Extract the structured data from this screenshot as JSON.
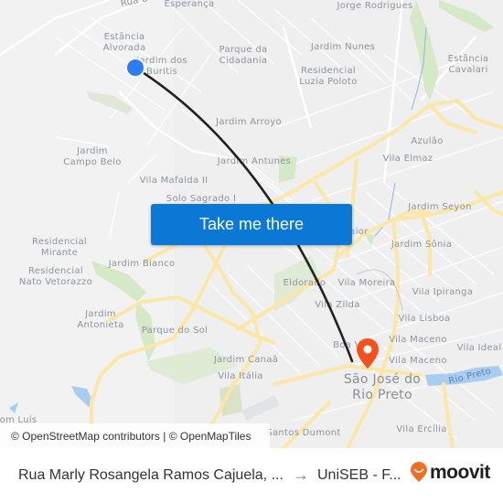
{
  "map": {
    "labels": [
      {
        "text": "Rua E",
        "kind": "street"
      },
      {
        "text": "Esperança",
        "kind": "area"
      },
      {
        "text": "Jorge Rodrigues",
        "kind": "area"
      },
      {
        "text": "Estância\nAlvorada",
        "kind": "area"
      },
      {
        "text": "Jardim dos\nBuritis",
        "kind": "area"
      },
      {
        "text": "Parque da\nCidadania",
        "kind": "area"
      },
      {
        "text": "Jardim Nunes",
        "kind": "area"
      },
      {
        "text": "Estância\nCavalari",
        "kind": "area"
      },
      {
        "text": "Residencial\nLuzia Poloto",
        "kind": "area"
      },
      {
        "text": "Jardim Arroyo",
        "kind": "area"
      },
      {
        "text": "Azulão",
        "kind": "area"
      },
      {
        "text": "Jardim\nCampo Belo",
        "kind": "area"
      },
      {
        "text": "Jardim Antunes",
        "kind": "area"
      },
      {
        "text": "Vila Elmaz",
        "kind": "area"
      },
      {
        "text": "Vila Mafalda II",
        "kind": "area"
      },
      {
        "text": "Solo Sagrado I",
        "kind": "area"
      },
      {
        "text": "Jardim Seyon",
        "kind": "area"
      },
      {
        "text": "Maior",
        "kind": "area"
      },
      {
        "text": "Residencial\nMirante",
        "kind": "area"
      },
      {
        "text": "Jardim Sônia",
        "kind": "area"
      },
      {
        "text": "Jardim Bianco",
        "kind": "area"
      },
      {
        "text": "Residencial\nNato Vetorazzo",
        "kind": "area"
      },
      {
        "text": "Eldorado",
        "kind": "area"
      },
      {
        "text": "Vila Moreira",
        "kind": "area"
      },
      {
        "text": "Vila Ipiranga",
        "kind": "area"
      },
      {
        "text": "Jardim\nAntonieta",
        "kind": "area"
      },
      {
        "text": "Vila Zilda",
        "kind": "area"
      },
      {
        "text": "Parque do Sol",
        "kind": "area"
      },
      {
        "text": "Vila Lisboa",
        "kind": "area"
      },
      {
        "text": "Boa Vista",
        "kind": "area"
      },
      {
        "text": "Vila Maceno",
        "kind": "area"
      },
      {
        "text": "Vila Ideal",
        "kind": "area"
      },
      {
        "text": "Jardim Canaã",
        "kind": "area"
      },
      {
        "text": "Vila Maceno",
        "kind": "area"
      },
      {
        "text": "Vila Itália",
        "kind": "area"
      },
      {
        "text": "São José do\nRio Preto",
        "kind": "city"
      },
      {
        "text": "Rio Preto",
        "kind": "river"
      },
      {
        "text": "Vila Ercília",
        "kind": "area"
      },
      {
        "text": "Santos Dumont",
        "kind": "area"
      },
      {
        "text": "Dom Luís",
        "kind": "area"
      }
    ],
    "origin_marker": {
      "label": "origin",
      "color": "#2f7df6"
    },
    "destination_marker": {
      "label": "destination",
      "color": "#f4511e"
    },
    "route_color": "#222222"
  },
  "cta": {
    "label": "Take me there",
    "color": "#0b78d6"
  },
  "attribution": {
    "text": "© OpenStreetMap contributors | © OpenMapTiles"
  },
  "footer": {
    "from": "Rua Marly Rosangela Ramos Cajuela, ...",
    "arrow": "→",
    "to": "UniSEB - F...",
    "brand": "moovit",
    "brand_color": "#f26f21"
  }
}
